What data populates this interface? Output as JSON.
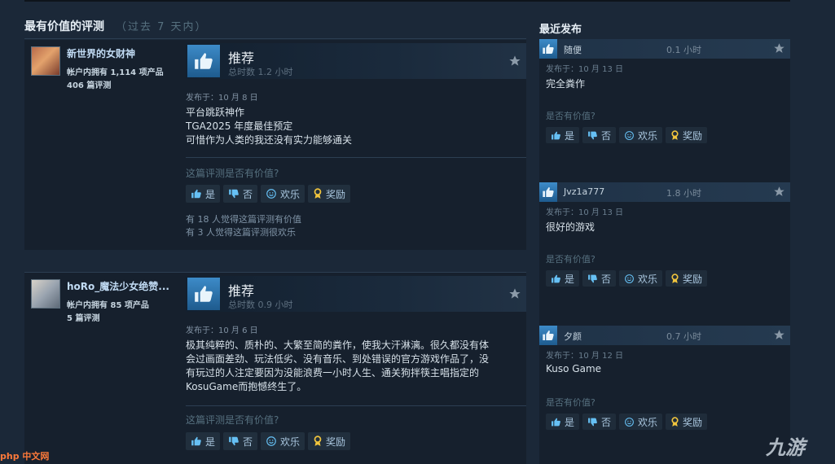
{
  "left": {
    "title": "最有价值的评测",
    "subtitle": "（过去 7 天内）",
    "reviews": [
      {
        "user": "新世界的女财神",
        "products": "帐户内拥有 1,114 项产品",
        "count": "406 篇评测",
        "rec": "推荐",
        "hours": "总时数 1.2 小时",
        "posted": "发布于：10 月 8 日",
        "lines": [
          "平台跳跃神作",
          "TGA2025 年度最佳预定",
          "可惜作为人类的我还没有实力能够通关"
        ],
        "helpful_q": "这篇评测是否有价值?",
        "yes": "是",
        "no": "否",
        "fun": "欢乐",
        "award": "奖励",
        "count1": "有 18 人觉得这篇评测有价值",
        "count2": "有 3 人觉得这篇评测很欢乐"
      },
      {
        "user": "hoRo_魔法少女绝赞...",
        "products": "帐户内拥有 85 项产品",
        "count": "5 篇评测",
        "rec": "推荐",
        "hours": "总时数 0.9 小时",
        "posted": "发布于：10 月 6 日",
        "lines": [
          "极其纯粹的、质朴的、大繁至简的粪作，使我大汗淋漓。很久都没有体",
          "会过画面差劲、玩法低劣、没有音乐、到处错误的官方游戏作品了，没",
          "有玩过的人注定要因为没能浪费一小时人生、通关狗拌筷主唱指定的",
          "KosuGame而抱憾终生了。"
        ],
        "helpful_q": "这篇评测是否有价值?",
        "yes": "是",
        "no": "否",
        "fun": "欢乐",
        "award": "奖励"
      }
    ]
  },
  "right": {
    "title": "最近发布",
    "cards": [
      {
        "name": "随便",
        "hours": "0.1 小时",
        "posted": "发布于：10 月 13 日",
        "text": "完全粪作",
        "q": "是否有价值?",
        "yes": "是",
        "no": "否",
        "fun": "欢乐",
        "award": "奖励"
      },
      {
        "name": "Jvz1a777",
        "hours": "1.8 小时",
        "posted": "发布于：10 月 13 日",
        "text": "很好的游戏",
        "q": "是否有价值?",
        "yes": "是",
        "no": "否",
        "fun": "欢乐",
        "award": "奖励"
      },
      {
        "name": "夕颜",
        "hours": "0.7 小时",
        "posted": "发布于：10 月 12 日",
        "text": "Kuso Game",
        "q": "是否有价值?",
        "yes": "是",
        "no": "否",
        "fun": "欢乐",
        "award": "奖励"
      }
    ]
  },
  "watermarks": {
    "left": "php 中文网",
    "right": "九游"
  },
  "colors": {
    "bg": "#1b2838",
    "accent": "#66c0f4",
    "thumb": "#3d8bc8"
  }
}
